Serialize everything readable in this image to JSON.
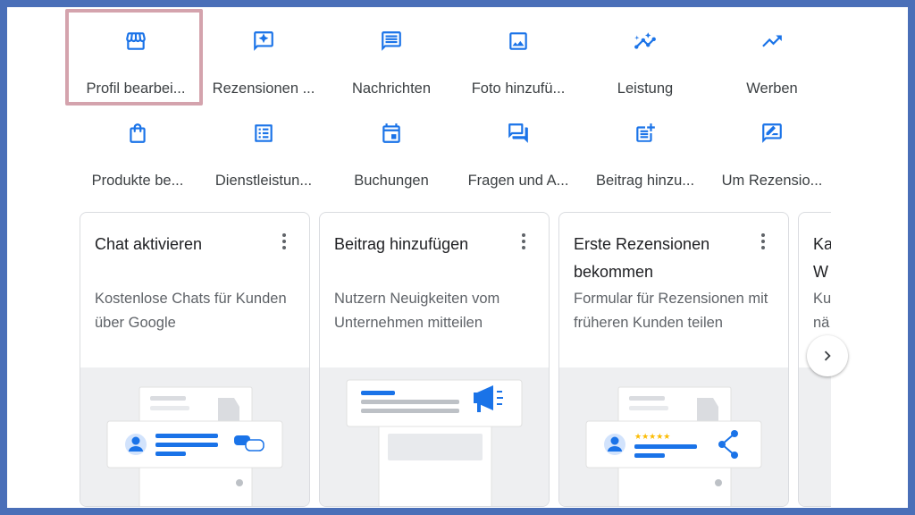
{
  "colors": {
    "accent": "#1a73e8",
    "highlight": "#d4a3ad",
    "frame": "#4a6fb8"
  },
  "actions": [
    {
      "label": "Profil bearbei...",
      "icon": "storefront-icon"
    },
    {
      "label": "Rezensionen ...",
      "icon": "review-star-icon"
    },
    {
      "label": "Nachrichten",
      "icon": "message-icon"
    },
    {
      "label": "Foto hinzufü...",
      "icon": "photo-icon"
    },
    {
      "label": "Leistung",
      "icon": "insights-trend-icon"
    },
    {
      "label": "Werben",
      "icon": "trending-up-icon"
    },
    {
      "label": "Produkte be...",
      "icon": "shopping-bag-icon"
    },
    {
      "label": "Dienstleistun...",
      "icon": "list-icon"
    },
    {
      "label": "Buchungen",
      "icon": "calendar-icon"
    },
    {
      "label": "Fragen und A...",
      "icon": "forum-icon"
    },
    {
      "label": "Beitrag hinzu...",
      "icon": "post-add-icon"
    },
    {
      "label": "Um Rezensio...",
      "icon": "rate-review-icon"
    }
  ],
  "cards": [
    {
      "title": "Chat aktivieren",
      "desc": "Kostenlose Chats für Kunden über Google"
    },
    {
      "title": "Beitrag hinzufügen",
      "desc": "Nutzern Neuigkeiten vom Unternehmen mitteilen"
    },
    {
      "title": "Erste Rezensionen bekommen",
      "desc": "Formular für Rezensionen mit früheren Kunden teilen"
    },
    {
      "title": "Ka W",
      "desc": "Ku nä"
    }
  ],
  "card4_lines": {
    "title1": "Ka",
    "title2": "W",
    "desc1": "Ku",
    "desc2": "nä"
  },
  "review_stars": "★★★★★"
}
